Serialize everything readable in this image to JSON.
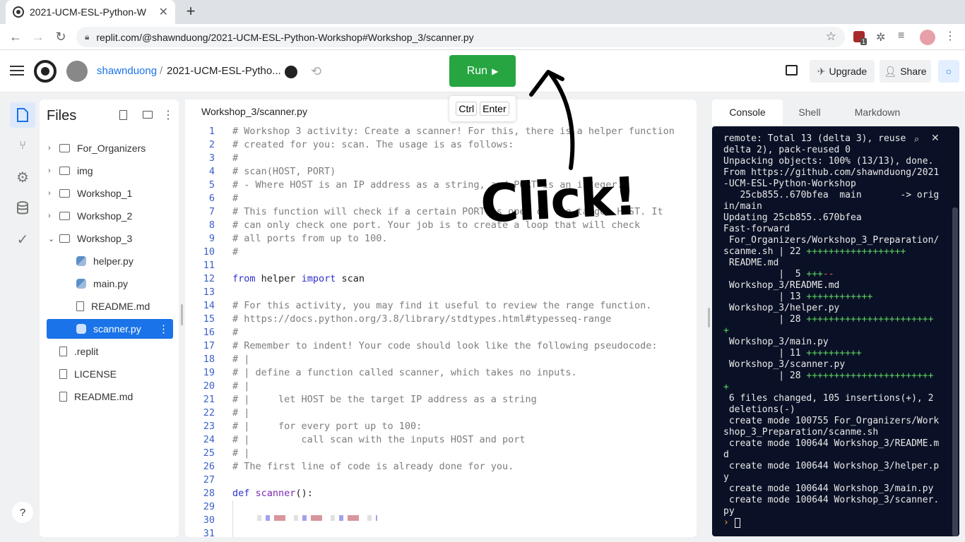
{
  "browser": {
    "tab_title": "2021-UCM-ESL-Python-W",
    "url": "replit.com/@shawnduong/2021-UCM-ESL-Python-Workshop#Workshop_3/scanner.py",
    "extension_badge": "1"
  },
  "header": {
    "username": "shawnduong",
    "separator": "/",
    "repl_name": "2021-UCM-ESL-Pytho...",
    "run_label": "Run",
    "shortcut_keys": [
      "Ctrl",
      "Enter"
    ],
    "upgrade_label": "Upgrade",
    "share_label": "Share",
    "accent_color": "#26a541"
  },
  "files": {
    "title": "Files",
    "items": [
      {
        "label": "For_Organizers",
        "type": "folder"
      },
      {
        "label": "img",
        "type": "folder"
      },
      {
        "label": "Workshop_1",
        "type": "folder"
      },
      {
        "label": "Workshop_2",
        "type": "folder"
      },
      {
        "label": "Workshop_3",
        "type": "folder-open"
      },
      {
        "label": "helper.py",
        "type": "python"
      },
      {
        "label": "main.py",
        "type": "python"
      },
      {
        "label": "README.md",
        "type": "file"
      },
      {
        "label": "scanner.py",
        "type": "python",
        "selected": true
      },
      {
        "label": ".replit",
        "type": "file"
      },
      {
        "label": "LICENSE",
        "type": "file"
      },
      {
        "label": "README.md",
        "type": "file"
      }
    ],
    "help_label": "?"
  },
  "editor": {
    "tab_label": "Workshop_3/scanner.py",
    "line_numbers": [
      "1",
      "2",
      "3",
      "4",
      "5",
      "6",
      "7",
      "8",
      "9",
      "10",
      "11",
      "12",
      "13",
      "14",
      "15",
      "16",
      "17",
      "18",
      "19",
      "20",
      "21",
      "22",
      "23",
      "24",
      "25",
      "26",
      "27",
      "28",
      "29",
      "30",
      "31"
    ],
    "lines": [
      "# Workshop 3 activity: Create a scanner! For this, there is a helper function",
      "# created for you: scan. The usage is as follows:",
      "#",
      "# scan(HOST, PORT)",
      "# - Where HOST is an IP address as a string, and PORT is an integer.",
      "#",
      "# This function will check if a certain PORT is open on the target HOST. It",
      "# can only check one port. Your job is to create a loop that will check",
      "# all ports from up to 100.",
      "#",
      "",
      "",
      "",
      "# For this activity, you may find it useful to review the range function.",
      "# https://docs.python.org/3.8/library/stdtypes.html#typesseq-range",
      "#",
      "# Remember to indent! Your code should look like the following pseudocode:",
      "# |",
      "# | define a function called scanner, which takes no inputs.",
      "# |",
      "# |     let HOST be the target IP address as a string",
      "# |",
      "# |     for every port up to 100:",
      "# |         call scan with the inputs HOST and port",
      "# |",
      "# The first line of code is already done for you.",
      "",
      "",
      "",
      "",
      ""
    ],
    "import_line": {
      "kw1": "from",
      "mod": "helper",
      "kw2": "import",
      "name": "scan"
    },
    "def_line": {
      "kw": "def",
      "name": "scanner",
      "rest": "():"
    }
  },
  "console": {
    "tabs": [
      "Console",
      "Shell",
      "Markdown"
    ],
    "lines": [
      {
        "t": "remote: Total 13 (delta 3), reuse"
      },
      {
        "t": "delta 2), pack-reused 0"
      },
      {
        "t": "Unpacking objects: 100% (13/13), done."
      },
      {
        "t": "From https://github.com/shawnduong/2021"
      },
      {
        "t": "-UCM-ESL-Python-Workshop"
      },
      {
        "t": "   25cb855..670bfea  main       -> orig"
      },
      {
        "t": "in/main"
      },
      {
        "t": "Updating 25cb855..670bfea"
      },
      {
        "t": "Fast-forward"
      },
      {
        "t": " For_Organizers/Workshop_3_Preparation/"
      },
      {
        "t": "scanme.sh | 22 ",
        "g": "++++++++++++++++++"
      },
      {
        "t": " README.md"
      },
      {
        "t": "          |  5 ",
        "g": "+++",
        "r": "--"
      },
      {
        "t": " Workshop_3/README.md"
      },
      {
        "t": "          | 13 ",
        "g": "++++++++++++"
      },
      {
        "t": " Workshop_3/helper.py"
      },
      {
        "t": "          | 28 ",
        "g": "+++++++++++++++++++++++"
      },
      {
        "t": "",
        "g": "+"
      },
      {
        "t": " Workshop_3/main.py"
      },
      {
        "t": "          | 11 ",
        "g": "++++++++++"
      },
      {
        "t": " Workshop_3/scanner.py"
      },
      {
        "t": "          | 28 ",
        "g": "+++++++++++++++++++++++"
      },
      {
        "t": "",
        "g": "+"
      },
      {
        "t": " 6 files changed, 105 insertions(+), 2"
      },
      {
        "t": " deletions(-)"
      },
      {
        "t": " create mode 100755 For_Organizers/Work"
      },
      {
        "t": "shop_3_Preparation/scanme.sh"
      },
      {
        "t": " create mode 100644 Workshop_3/README.m"
      },
      {
        "t": "d"
      },
      {
        "t": " create mode 100644 Workshop_3/helper.p"
      },
      {
        "t": "y"
      },
      {
        "t": " create mode 100644 Workshop_3/main.py"
      },
      {
        "t": " create mode 100644 Workshop_3/scanner."
      },
      {
        "t": "py"
      }
    ],
    "bg_color": "#0a1126"
  },
  "annotation": {
    "text": "Click!"
  }
}
